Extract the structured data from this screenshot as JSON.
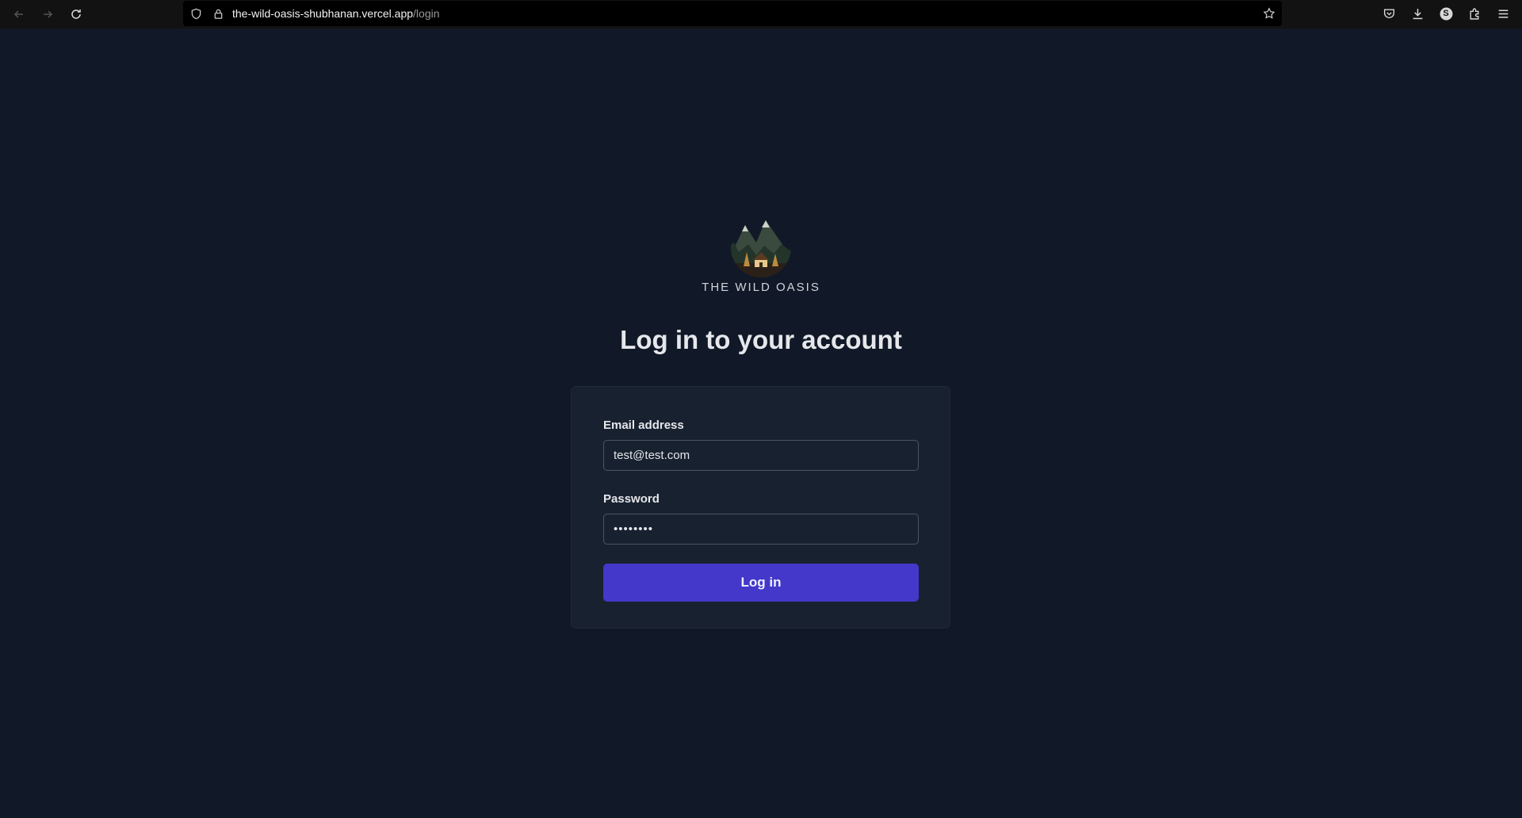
{
  "browser": {
    "url_host": "the-wild-oasis-shubhanan.vercel.app",
    "url_path": "/login",
    "profile_initial": "S",
    "icons": [
      "back-icon",
      "forward-icon",
      "reload-icon",
      "shield-icon",
      "lock-icon",
      "bookmark-star-icon",
      "pocket-icon",
      "download-icon",
      "profile-icon",
      "extensions-icon",
      "menu-icon"
    ]
  },
  "logo": {
    "brand_name": "THE WILD OASIS"
  },
  "login": {
    "heading": "Log in to your account",
    "email_label": "Email address",
    "email_value": "test@test.com",
    "password_label": "Password",
    "password_value": "••••••••",
    "submit_label": "Log in"
  },
  "colors": {
    "page_bg": "#111827",
    "card_bg": "#18212f",
    "accent": "#4338ca"
  }
}
